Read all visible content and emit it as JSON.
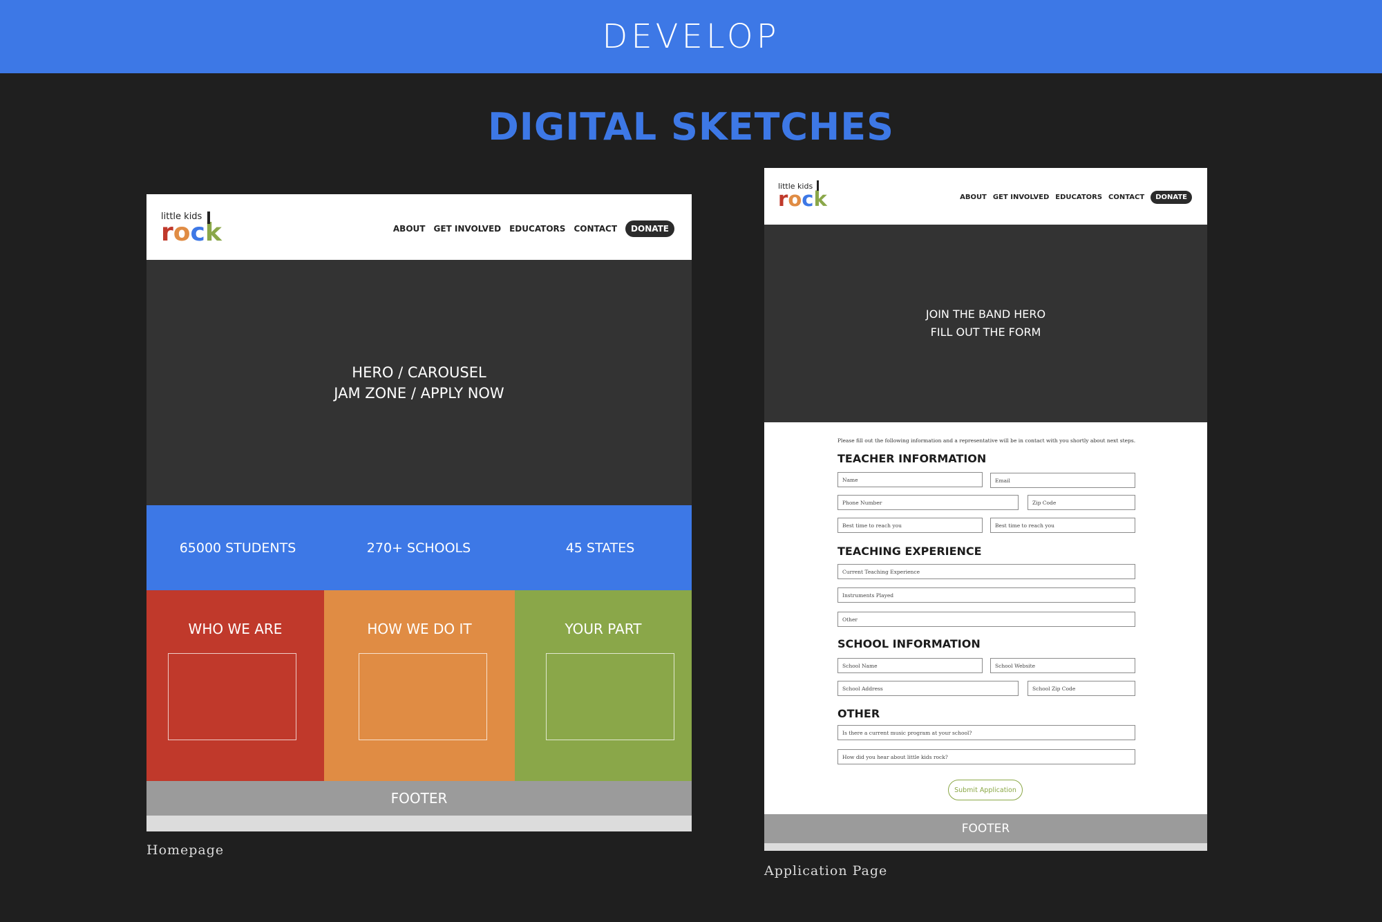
{
  "header": {
    "title": "DEVELOP"
  },
  "section": {
    "title": "DIGITAL SKETCHES"
  },
  "colors": {
    "accent_blue": "#3d78e6",
    "red": "#c0392b",
    "orange": "#e08c44",
    "green": "#8aa749",
    "dark": "#333333",
    "footer_gray": "#9b9b9b"
  },
  "logo": {
    "small": "little kids",
    "r": "r",
    "o": "o",
    "c": "c",
    "k": "k"
  },
  "nav": {
    "about": "ABOUT",
    "get_involved": "GET INVOLVED",
    "educators": "EDUCATORS",
    "contact": "CONTACT",
    "donate": "DONATE"
  },
  "homepage": {
    "caption": "Homepage",
    "hero_line1": "HERO / CAROUSEL",
    "hero_line2": "JAM ZONE / APPLY NOW",
    "stats": [
      "65000 STUDENTS",
      "270+ SCHOOLS",
      "45 STATES"
    ],
    "panels": [
      "WHO WE ARE",
      "HOW WE DO IT",
      "YOUR PART"
    ],
    "footer": "FOOTER"
  },
  "application": {
    "caption": "Application Page",
    "hero_line1": "JOIN THE BAND HERO",
    "hero_line2": "FILL OUT THE FORM",
    "intro": "Please fill out the following information and a representative will be in contact with you shortly about next steps.",
    "teacher_heading": "TEACHER INFORMATION",
    "teacher_fields": [
      "Name",
      "Email",
      "Phone Number",
      "Zip Code",
      "Best time to reach you",
      "Best time to reach you"
    ],
    "teaching_heading": "TEACHING EXPERIENCE",
    "teaching_fields": [
      "Current Teaching Experience",
      "Instruments Played",
      "Other"
    ],
    "school_heading": "SCHOOL INFORMATION",
    "school_fields": [
      "School Name",
      "School Website",
      "School Address",
      "School Zip Code"
    ],
    "other_heading": "OTHER",
    "other_fields": [
      "Is there a current music program at your school?",
      "How did you hear about little kids rock?"
    ],
    "submit": "Submit Application",
    "footer": "FOOTER"
  }
}
